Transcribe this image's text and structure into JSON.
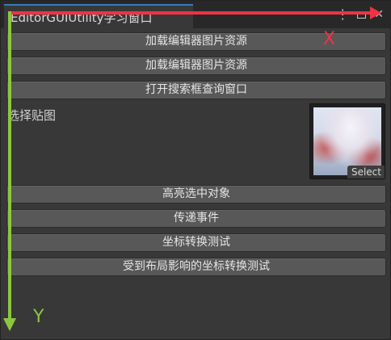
{
  "window": {
    "tab_title": "EditorGUIUtility学习窗口",
    "controls": {
      "kebab": "⋮",
      "close": "✕"
    }
  },
  "buttons": [
    {
      "label": "加载编辑器图片资源"
    },
    {
      "label": "加载编辑器图片资源"
    },
    {
      "label": "打开搜索框查询窗口"
    },
    {
      "label": "高亮选中对象"
    },
    {
      "label": "传递事件"
    },
    {
      "label": "坐标转换测试"
    },
    {
      "label": "受到布局影响的坐标转换测试"
    }
  ],
  "texture_field": {
    "label": "选择贴图",
    "select_label": "Select"
  },
  "annotations": {
    "x_label": "X",
    "y_label": "Y",
    "x_color": "#ee3344",
    "y_color": "#8cc63f"
  },
  "colors": {
    "accent_tab": "#3a79bb",
    "button_bg": "#585858",
    "window_bg": "#383838"
  }
}
